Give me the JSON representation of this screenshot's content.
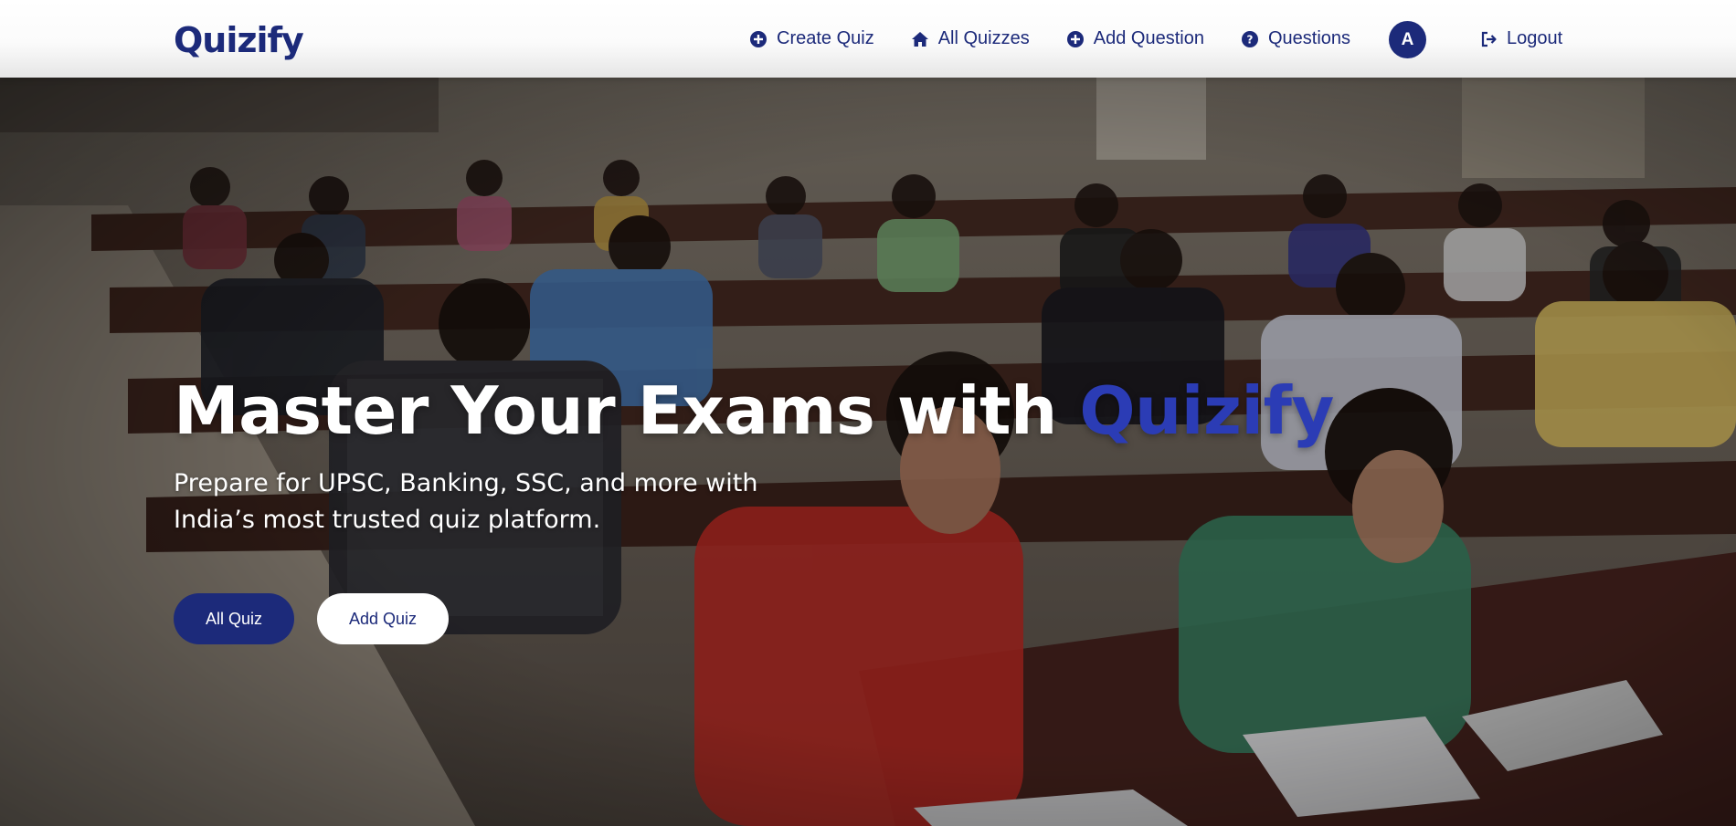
{
  "app": {
    "brand": "Quizify"
  },
  "nav": {
    "items": [
      {
        "label": "Create Quiz",
        "icon": "plus-circle-icon"
      },
      {
        "label": "All Quizzes",
        "icon": "home-icon"
      },
      {
        "label": "Add Question",
        "icon": "plus-circle-icon"
      },
      {
        "label": "Questions",
        "icon": "question-circle-icon"
      }
    ],
    "avatar_initial": "A",
    "logout_label": "Logout",
    "logout_icon": "sign-out-icon"
  },
  "hero": {
    "title_main": "Master Your Exams with ",
    "title_accent": "Quizify",
    "subtitle": "Prepare for UPSC, Banking, SSC, and more with India’s most trusted quiz platform.",
    "buttons": {
      "primary": "All Quiz",
      "secondary": "Add Quiz"
    },
    "background_image": "students-writing-exam-in-classroom"
  },
  "colors": {
    "brand": "#1c2a7a",
    "accent": "#2b3cb5",
    "white": "#ffffff"
  }
}
